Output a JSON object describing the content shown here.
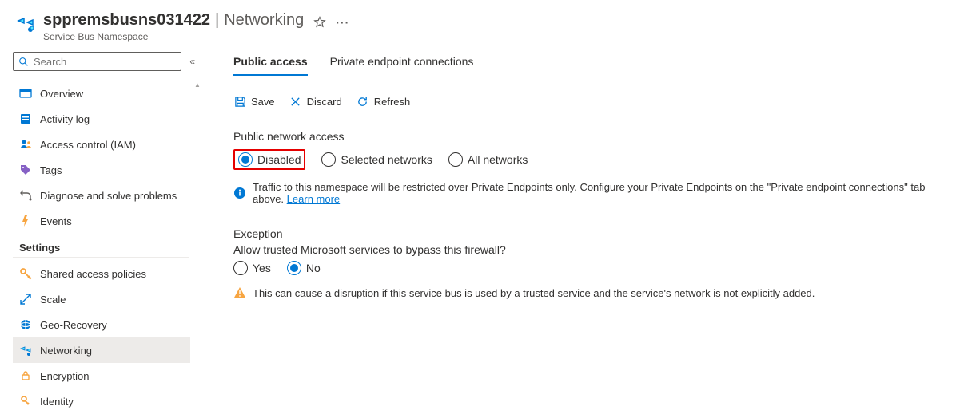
{
  "header": {
    "resource_name": "sppremsbusns031422",
    "section": "Networking",
    "subtitle": "Service Bus Namespace"
  },
  "sidebar": {
    "search_placeholder": "Search",
    "items_top": [
      {
        "label": "Overview",
        "icon": "overview"
      },
      {
        "label": "Activity log",
        "icon": "activity"
      },
      {
        "label": "Access control (IAM)",
        "icon": "access"
      },
      {
        "label": "Tags",
        "icon": "tags"
      },
      {
        "label": "Diagnose and solve problems",
        "icon": "diagnose"
      },
      {
        "label": "Events",
        "icon": "events"
      }
    ],
    "group_label": "Settings",
    "items_settings": [
      {
        "label": "Shared access policies",
        "icon": "key"
      },
      {
        "label": "Scale",
        "icon": "scale"
      },
      {
        "label": "Geo-Recovery",
        "icon": "geo"
      },
      {
        "label": "Networking",
        "icon": "networking",
        "active": true
      },
      {
        "label": "Encryption",
        "icon": "lock"
      },
      {
        "label": "Identity",
        "icon": "identity"
      }
    ]
  },
  "tabs": {
    "public_access": "Public access",
    "private_endpoint": "Private endpoint connections"
  },
  "toolbar": {
    "save": "Save",
    "discard": "Discard",
    "refresh": "Refresh"
  },
  "public_network_access": {
    "label": "Public network access",
    "options": {
      "disabled": "Disabled",
      "selected_networks": "Selected networks",
      "all_networks": "All networks"
    },
    "selected": "disabled",
    "info_text": "Traffic to this namespace will be restricted over Private Endpoints only. Configure your Private Endpoints on the \"Private endpoint connections\" tab above.",
    "learn_more": "Learn more"
  },
  "exception": {
    "label": "Exception",
    "question": "Allow trusted Microsoft services to bypass this firewall?",
    "yes": "Yes",
    "no": "No",
    "selected": "no",
    "warning_text": "This can cause a disruption if this service bus is used by a trusted service and the service's network is not explicitly added."
  }
}
